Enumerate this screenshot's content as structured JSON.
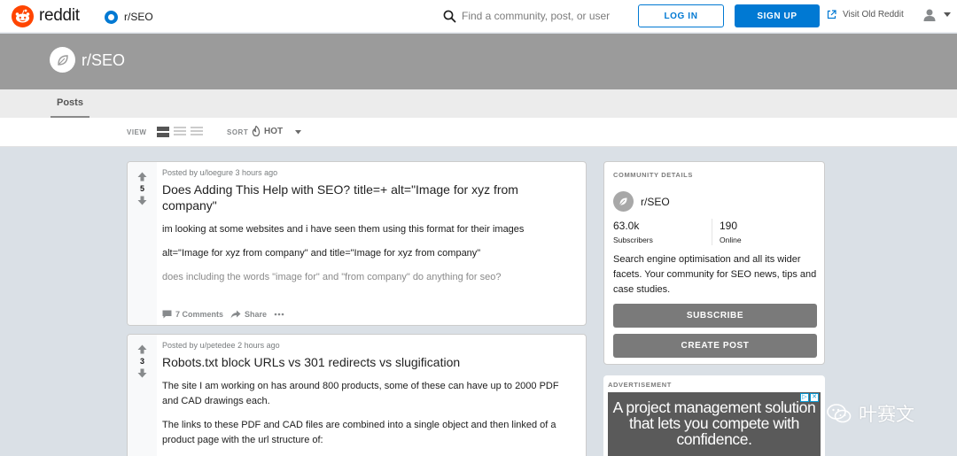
{
  "header": {
    "brand": "reddit",
    "community_select": "r/SEO",
    "search_placeholder": "Find a community, post, or user",
    "login_label": "LOG IN",
    "signup_label": "SIGN UP",
    "old_reddit_label": "Visit Old Reddit"
  },
  "banner": {
    "title": "r/SEO"
  },
  "tabs": {
    "posts": "Posts"
  },
  "viewbar": {
    "view_label": "VIEW",
    "sort_label": "SORT",
    "sort_value": "HOT"
  },
  "posts": [
    {
      "votes": "5",
      "meta": "Posted by u/loegure 3 hours ago",
      "title": "Does Adding This Help with SEO? title=+ alt=\"Image for xyz from company\"",
      "paragraphs": [
        "im looking at some websites and i have seen them using this format for their images",
        "alt=\"Image for xyz from company\" and title=\"Image for xyz from company\"",
        "does including the words \"image for\" and \"from company\" do anything for seo?"
      ],
      "comments": "7 Comments",
      "share": "Share"
    },
    {
      "votes": "3",
      "meta": "Posted by u/petedee 2 hours ago",
      "title": "Robots.txt block URLs vs 301 redirects vs slugification",
      "paragraphs": [
        "The site I am working on has around 800 products, some of these can have up to 2000 PDF and CAD drawings each.",
        "The links to these PDF and CAD files are combined into a single object and then linked of a product page with the url structure of:"
      ]
    }
  ],
  "sidebar": {
    "heading": "COMMUNITY DETAILS",
    "name": "r/SEO",
    "subscribers_value": "63.0k",
    "subscribers_label": "Subscribers",
    "online_value": "190",
    "online_label": "Online",
    "description": "Search engine optimisation and all its wider facets. Your community for SEO news, tips and case studies.",
    "subscribe_label": "SUBSCRIBE",
    "create_post_label": "CREATE POST"
  },
  "ad": {
    "label": "ADVERTISEMENT",
    "text": "A project management solution that lets you compete with confidence."
  },
  "watermark": {
    "text": "叶赛文"
  },
  "colors": {
    "brand": "#ff4500",
    "accent": "#0079d3",
    "banner": "#9b9b9b",
    "button_gray": "#7a7a7a"
  }
}
